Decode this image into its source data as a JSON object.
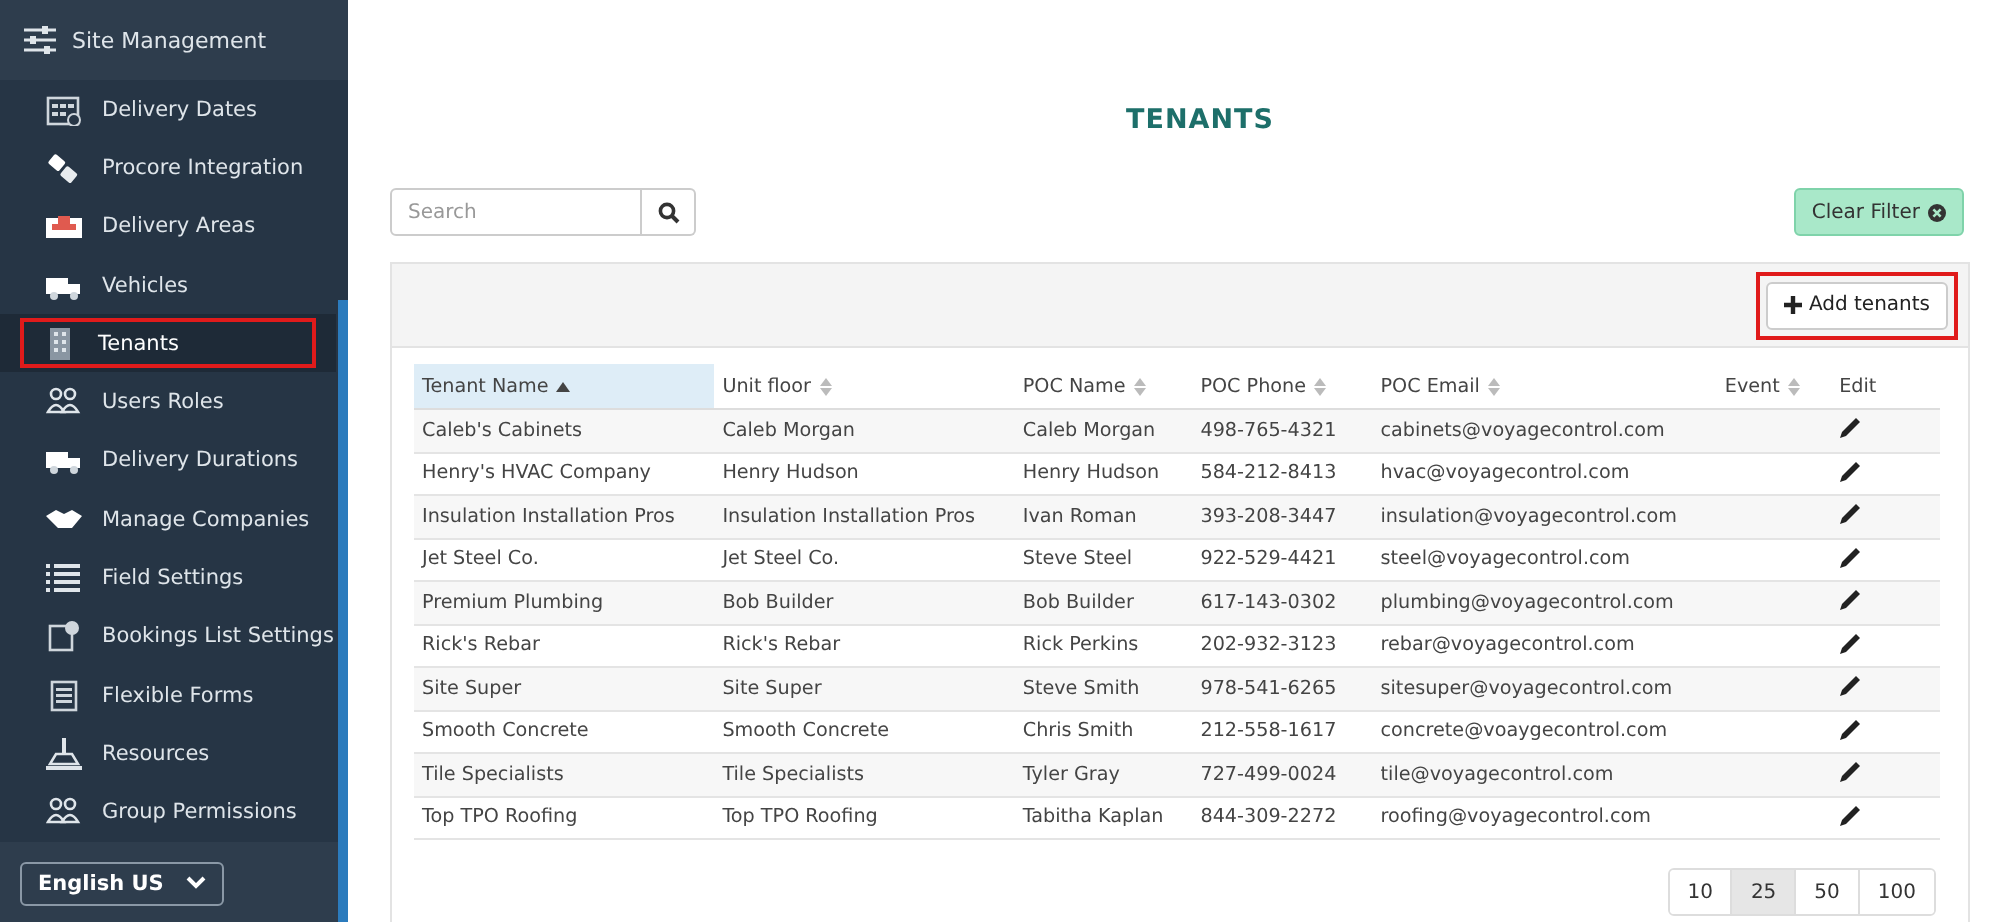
{
  "sidebar": {
    "header": "Site Management",
    "items": [
      {
        "label": "Delivery Dates",
        "selected": false,
        "highlighted": false
      },
      {
        "label": "Procore Integration",
        "selected": false,
        "highlighted": false
      },
      {
        "label": "Delivery Areas",
        "selected": false,
        "highlighted": false
      },
      {
        "label": "Vehicles",
        "selected": false,
        "highlighted": false
      },
      {
        "label": "Tenants",
        "selected": true,
        "highlighted": true
      },
      {
        "label": "Users Roles",
        "selected": false,
        "highlighted": false
      },
      {
        "label": "Delivery Durations",
        "selected": false,
        "highlighted": false
      },
      {
        "label": "Manage Companies",
        "selected": false,
        "highlighted": false
      },
      {
        "label": "Field Settings",
        "selected": false,
        "highlighted": false
      },
      {
        "label": "Bookings List Settings",
        "selected": false,
        "highlighted": false
      },
      {
        "label": "Flexible Forms",
        "selected": false,
        "highlighted": false
      },
      {
        "label": "Resources",
        "selected": false,
        "highlighted": false
      },
      {
        "label": "Group Permissions",
        "selected": false,
        "highlighted": false
      }
    ],
    "language": "English US"
  },
  "title": "TENANTS",
  "search": {
    "placeholder": "Search"
  },
  "clear_filter": {
    "label": "Clear Filter"
  },
  "add_button": {
    "label": "Add tenants",
    "highlighted": true
  },
  "table": {
    "columns": [
      {
        "label": "Tenant Name",
        "sorted": true
      },
      {
        "label": "Unit floor",
        "sorted": false
      },
      {
        "label": "POC Name",
        "sorted": false
      },
      {
        "label": "POC Phone",
        "sorted": false
      },
      {
        "label": "POC Email",
        "sorted": false
      },
      {
        "label": "Event",
        "sorted": false
      },
      {
        "label": "Edit"
      }
    ],
    "rows": [
      [
        "Caleb's Cabinets",
        "Caleb Morgan",
        "Caleb Morgan",
        "498-765-4321",
        "cabinets@voyagecontrol.com"
      ],
      [
        "Henry's HVAC Company",
        "Henry Hudson",
        "Henry Hudson",
        "584-212-8413",
        "hvac@voyagecontrol.com"
      ],
      [
        "Insulation Installation Pros",
        "Insulation Installation Pros",
        "Ivan Roman",
        "393-208-3447",
        "insulation@voyagecontrol.com"
      ],
      [
        "Jet Steel Co.",
        "Jet Steel Co.",
        "Steve Steel",
        "922-529-4421",
        "steel@voyagecontrol.com"
      ],
      [
        "Premium Plumbing",
        "Bob Builder",
        "Bob Builder",
        "617-143-0302",
        "plumbing@voyagecontrol.com"
      ],
      [
        "Rick's Rebar",
        "Rick's Rebar",
        "Rick Perkins",
        "202-932-3123",
        "rebar@voyagecontrol.com"
      ],
      [
        "Site Super",
        "Site Super",
        "Steve Smith",
        "978-541-6265",
        "sitesuper@voyagecontrol.com"
      ],
      [
        "Smooth Concrete",
        "Smooth Concrete",
        "Chris Smith",
        "212-558-1617",
        "concrete@voaygecontrol.com"
      ],
      [
        "Tile Specialists",
        "Tile Specialists",
        "Tyler Gray",
        "727-499-0024",
        "tile@voyagecontrol.com"
      ],
      [
        "Top TPO Roofing",
        "Top TPO Roofing",
        "Tabitha Kaplan",
        "844-309-2272",
        "roofing@voyagecontrol.com"
      ]
    ]
  },
  "page_sizes": [
    {
      "label": "10",
      "selected": false
    },
    {
      "label": "25",
      "selected": true
    },
    {
      "label": "50",
      "selected": false
    },
    {
      "label": "100",
      "selected": false
    }
  ]
}
